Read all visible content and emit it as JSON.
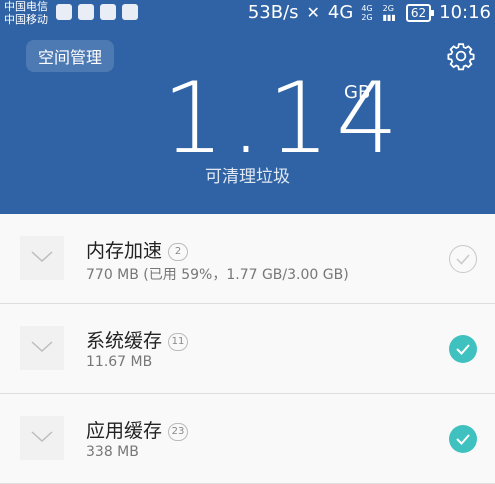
{
  "status_bar": {
    "carrier1": "中国电信",
    "carrier2": "中国移动",
    "net_speed": "53B/s",
    "network": "4G",
    "signal_small_top": "4G",
    "signal_small_mid": "2G",
    "signal_small_right": "2G",
    "battery": "62",
    "time": "10:16"
  },
  "header": {
    "space_button": "空间管理",
    "junk_size": "1.14",
    "junk_unit": "GB",
    "junk_label": "可清理垃圾"
  },
  "items": [
    {
      "title": "内存加速",
      "count": "2",
      "detail": "770 MB (已用 59%，1.77 GB/3.00 GB)",
      "checked": false
    },
    {
      "title": "系统缓存",
      "count": "11",
      "detail": "11.67 MB",
      "checked": true
    },
    {
      "title": "应用缓存",
      "count": "23",
      "detail": "338 MB",
      "checked": true
    }
  ],
  "colors": {
    "header": "#2f63a6",
    "accent": "#3fc1c0"
  }
}
